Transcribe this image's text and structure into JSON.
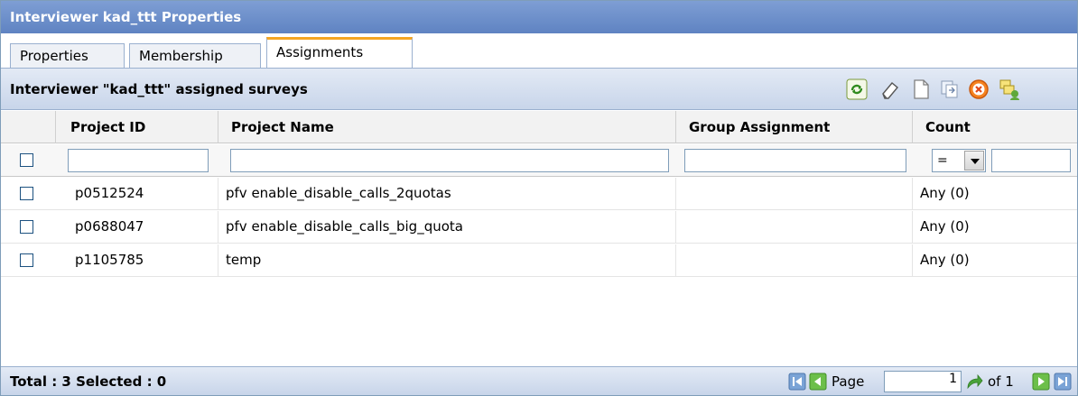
{
  "window": {
    "title": "Interviewer kad_ttt Properties"
  },
  "tabs": [
    {
      "label": "Properties"
    },
    {
      "label": "Membership"
    },
    {
      "label": "Assignments"
    }
  ],
  "toolbar": {
    "title": "Interviewer \"kad_ttt\" assigned surveys",
    "icons": [
      "refresh-icon",
      "eraser-icon",
      "new-page-icon",
      "copy-icon",
      "cancel-icon",
      "assign-icon"
    ]
  },
  "grid": {
    "columns": [
      "Project ID",
      "Project Name",
      "Group Assignment",
      "Count"
    ],
    "count_filter_operator": "=",
    "rows": [
      {
        "project_id": "p0512524",
        "project_name": "pfv enable_disable_calls_2quotas",
        "group_assignment": "",
        "count": "Any (0)"
      },
      {
        "project_id": "p0688047",
        "project_name": "pfv enable_disable_calls_big_quota",
        "group_assignment": "",
        "count": "Any (0)"
      },
      {
        "project_id": "p1105785",
        "project_name": "temp",
        "group_assignment": "",
        "count": "Any (0)"
      }
    ]
  },
  "status": {
    "summary": "Total : 3 Selected : 0",
    "page_label": "Page",
    "page_value": "1",
    "of_label": "of 1"
  },
  "colors": {
    "title_bar": "#6a8cc8",
    "toolbar": "#d6e0f0",
    "tab_accent": "#f5a623"
  }
}
